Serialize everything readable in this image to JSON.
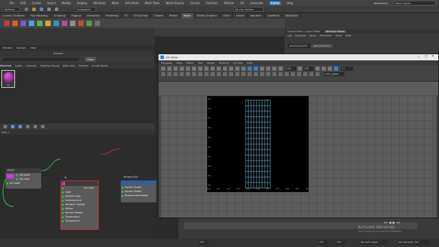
{
  "menubar": {
    "items": [
      "File",
      "Edit",
      "Create",
      "Select",
      "Modify",
      "Display",
      "Windows",
      "Mesh",
      "Edit Mesh",
      "Mesh Tools",
      "Mesh Display",
      "Curves",
      "Surfaces",
      "Deform",
      "UV",
      "Generate",
      "Cache",
      "Help"
    ],
    "uv_highlight": "Create",
    "workspace_label": "Workspace:",
    "workspace_value": "Maya Classic"
  },
  "status": {
    "mode": "Modeling",
    "symmetry": "No Live Surface",
    "components_label": "Components"
  },
  "shelf_tabs": [
    "Curves / Surfaces",
    "Poly Modeling",
    "Sculpting",
    "Rigging",
    "Animation",
    "Rendering",
    "FX",
    "FX Caching",
    "Custom",
    "Bifrost",
    "MASH",
    "Motion Graphics",
    "XGen",
    "Arnold",
    "aboutme",
    "Qualifiont",
    "BodyPaint"
  ],
  "shelf_active": "MASH",
  "panel_menu": [
    "View",
    "Shading",
    "Lighting",
    "Show",
    "Renderer",
    "Panels"
  ],
  "right_panel": {
    "tabs": [
      "Channel Box / Layer Editor",
      "Attribute Editor"
    ],
    "menus": [
      "List",
      "Selected",
      "Focus",
      "Attributes",
      "Show",
      "Help"
    ],
    "node_tab_1": "polySweepUV1",
    "node_tab_2": "polyCylinder1"
  },
  "hypershade": {
    "menus": [
      "Window",
      "Options",
      "Help"
    ],
    "browser_title": "Browser",
    "browser_tabs": [
      "Materials",
      "Lights",
      "Cameras",
      "Shading Groups",
      "Bake Sets",
      "Projects",
      "Arnold Nodes"
    ],
    "show_button": "Show",
    "swatch_label": "lb",
    "tab_name": "tab1_1"
  },
  "nodes": {
    "ramp": {
      "title": "ramp1",
      "attrs": [
        "Out Alpha",
        "Out Color"
      ],
      "bottom": "UV Coord"
    },
    "lambert_src": {
      "title": "lb",
      "out": "Out Color",
      "attrs": [
        "Color",
        "Ambient Color",
        "Incandescence",
        "Hardware Opacity",
        "Diffuse",
        "Normal Camera",
        "Translucence",
        "Transparency"
      ]
    },
    "lambert_sg": {
      "title": "lambert2SG",
      "attrs": [
        "Surface Shader",
        "Volume Shader",
        "Displacement Shader"
      ]
    }
  },
  "uv_editor": {
    "title": "UV Editor",
    "menus": [
      "Polygons",
      "View",
      "Select",
      "Tool",
      "Image",
      "Textures",
      "UV Sets",
      "Help"
    ],
    "field_a": "0.00",
    "field_b": "1.00",
    "field_c": "1.1",
    "uvset": "uvSet_gbless",
    "tick_values_x": [
      "0.0",
      "0.1",
      "0.2",
      "0.3",
      "0.4",
      "0.5",
      "0.6",
      "0.7",
      "0.8",
      "0.9",
      "1.0"
    ],
    "tick_values_y": [
      "0.0",
      "0.1",
      "0.2",
      "0.3",
      "0.4",
      "0.5",
      "0.6",
      "0.7",
      "0.8",
      "0.9"
    ]
  },
  "timeline": {
    "start": "120",
    "end": "120",
    "range_start": "1",
    "range_end": "200",
    "anim_layer": "No Anim Layer",
    "char_set": "No Character Set"
  },
  "watermark": {
    "line1": "Activate Windows",
    "line2": "Go to Settings to activate Windows."
  },
  "colors": {
    "uv_bg": "#000000",
    "uv_lines": "#7ecff1",
    "node_selected": "#d42b2b",
    "node_sg_header": "#3b5b97",
    "accent_green": "#2fbf4a"
  }
}
